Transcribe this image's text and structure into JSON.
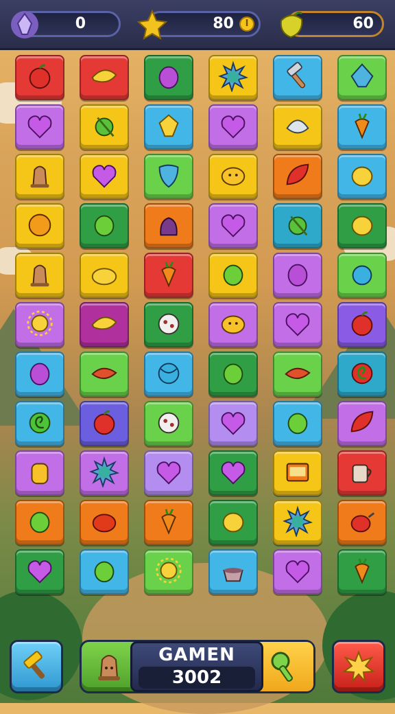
{
  "resources": [
    {
      "name": "crystal",
      "value": "0",
      "icon": "crystal-icon",
      "color": "#9b7bd6"
    },
    {
      "name": "gold",
      "value": "80",
      "icon": "star-gem-icon",
      "color": "#f2c21e",
      "coin": "I"
    },
    {
      "name": "energy",
      "value": "60",
      "icon": "fruit-icon",
      "color": "#d7d12a"
    }
  ],
  "board": {
    "rows": 11,
    "cols": 6,
    "tiles": [
      [
        {
          "c": "#e53935",
          "i": "apple"
        },
        {
          "c": "#e53935",
          "i": "banana"
        },
        {
          "c": "#2f9e44",
          "i": "plum"
        },
        {
          "c": "#f5c518",
          "i": "spiky-ball"
        },
        {
          "c": "#43b6e8",
          "i": "hammer"
        },
        {
          "c": "#69d14a",
          "i": "crystal"
        }
      ],
      [
        {
          "c": "#c26ee6",
          "i": "heart"
        },
        {
          "c": "#f5c518",
          "i": "green-fruit"
        },
        {
          "c": "#43b6e8",
          "i": "yellow-gem"
        },
        {
          "c": "#c26ee6",
          "i": "heart"
        },
        {
          "c": "#f5c518",
          "i": "shell"
        },
        {
          "c": "#43b6e8",
          "i": "carrot"
        }
      ],
      [
        {
          "c": "#f5c518",
          "i": "bell"
        },
        {
          "c": "#f5c518",
          "i": "heart"
        },
        {
          "c": "#69d14a",
          "i": "shield"
        },
        {
          "c": "#f5c518",
          "i": "lemon-face"
        },
        {
          "c": "#f07b1a",
          "i": "leaf"
        },
        {
          "c": "#43b6e8",
          "i": "lemon"
        }
      ],
      [
        {
          "c": "#f5c518",
          "i": "orange"
        },
        {
          "c": "#2f9e44",
          "i": "lime"
        },
        {
          "c": "#f07b1a",
          "i": "bag"
        },
        {
          "c": "#c26ee6",
          "i": "heart"
        },
        {
          "c": "#2fa9c9",
          "i": "green-fruit"
        },
        {
          "c": "#2f9e44",
          "i": "lemon"
        }
      ],
      [
        {
          "c": "#f5c518",
          "i": "bell"
        },
        {
          "c": "#f5c518",
          "i": "pear"
        },
        {
          "c": "#e53935",
          "i": "carrot"
        },
        {
          "c": "#f5c518",
          "i": "lime"
        },
        {
          "c": "#c26ee6",
          "i": "plum"
        },
        {
          "c": "#69d14a",
          "i": "berry"
        }
      ],
      [
        {
          "c": "#c26ee6",
          "i": "sun"
        },
        {
          "c": "#b0309e",
          "i": "banana"
        },
        {
          "c": "#2f9e44",
          "i": "cookie"
        },
        {
          "c": "#c26ee6",
          "i": "lemon-face"
        },
        {
          "c": "#c26ee6",
          "i": "heart"
        },
        {
          "c": "#8a5ce6",
          "i": "apple"
        }
      ],
      [
        {
          "c": "#43b6e8",
          "i": "plum"
        },
        {
          "c": "#69d14a",
          "i": "chili"
        },
        {
          "c": "#43b6e8",
          "i": "ball"
        },
        {
          "c": "#2f9e44",
          "i": "lime"
        },
        {
          "c": "#69d14a",
          "i": "chili"
        },
        {
          "c": "#2fa9c9",
          "i": "swirl-apple"
        }
      ],
      [
        {
          "c": "#43b6e8",
          "i": "swirl"
        },
        {
          "c": "#6b5fe0",
          "i": "apple"
        },
        {
          "c": "#69d14a",
          "i": "cookie"
        },
        {
          "c": "#b38ef0",
          "i": "heart"
        },
        {
          "c": "#43b6e8",
          "i": "lime"
        },
        {
          "c": "#c26ee6",
          "i": "leaf"
        }
      ],
      [
        {
          "c": "#c26ee6",
          "i": "jar"
        },
        {
          "c": "#c26ee6",
          "i": "spiky-ball"
        },
        {
          "c": "#b38ef0",
          "i": "heart"
        },
        {
          "c": "#2f9e44",
          "i": "heart"
        },
        {
          "c": "#f5c518",
          "i": "sign"
        },
        {
          "c": "#e53935",
          "i": "mug"
        }
      ],
      [
        {
          "c": "#f07b1a",
          "i": "lime"
        },
        {
          "c": "#f07b1a",
          "i": "tomato"
        },
        {
          "c": "#f07b1a",
          "i": "carrot"
        },
        {
          "c": "#2f9e44",
          "i": "lemon"
        },
        {
          "c": "#f5c518",
          "i": "spiky-ball"
        },
        {
          "c": "#f07b1a",
          "i": "jug"
        }
      ],
      [
        {
          "c": "#2f9e44",
          "i": "heart"
        },
        {
          "c": "#43b6e8",
          "i": "lime"
        },
        {
          "c": "#69d14a",
          "i": "sun"
        },
        {
          "c": "#43b6e8",
          "i": "pot"
        },
        {
          "c": "#c26ee6",
          "i": "heart"
        },
        {
          "c": "#2f9e44",
          "i": "carrot"
        }
      ]
    ]
  },
  "bottom": {
    "left_button_icon": "hammer-icon",
    "left_button_color": "#43b6e8",
    "panel_left_icon": "bell-icon",
    "panel_right_icon": "key-icon",
    "score_label": "GAMEN",
    "score_value": "3002",
    "right_button_icon": "burst-icon",
    "right_button_color": "#e53935"
  }
}
